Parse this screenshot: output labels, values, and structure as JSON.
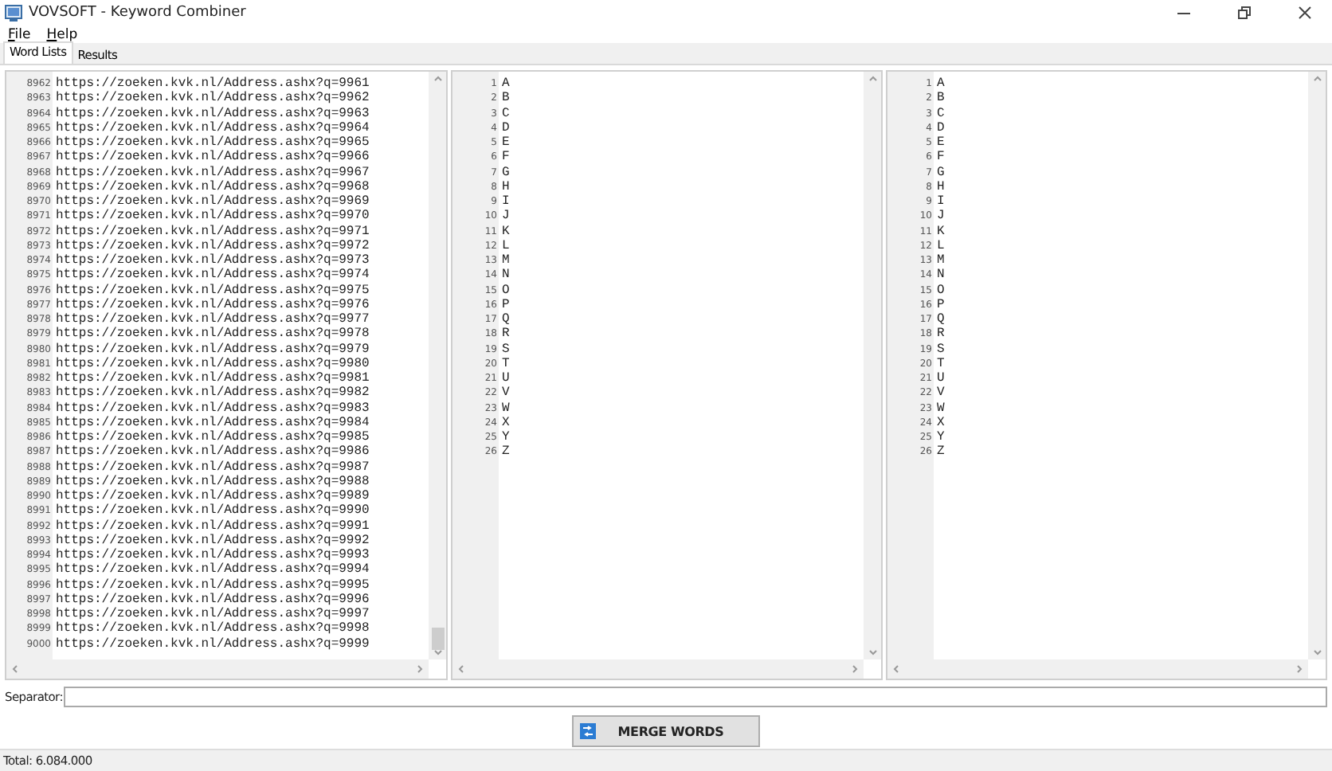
{
  "window": {
    "title": "VOVSOFT - Keyword Combiner"
  },
  "menu": [
    "File",
    "Help"
  ],
  "tabs": [
    {
      "label": "Word Lists",
      "selected": true
    },
    {
      "label": "Results",
      "selected": false
    }
  ],
  "word_lists": [
    {
      "lines": [
        {
          "n": "8962",
          "t": "https://zoeken.kvk.nl/Address.ashx?q=9961"
        },
        {
          "n": "8963",
          "t": "https://zoeken.kvk.nl/Address.ashx?q=9962"
        },
        {
          "n": "8964",
          "t": "https://zoeken.kvk.nl/Address.ashx?q=9963"
        },
        {
          "n": "8965",
          "t": "https://zoeken.kvk.nl/Address.ashx?q=9964"
        },
        {
          "n": "8966",
          "t": "https://zoeken.kvk.nl/Address.ashx?q=9965"
        },
        {
          "n": "8967",
          "t": "https://zoeken.kvk.nl/Address.ashx?q=9966"
        },
        {
          "n": "8968",
          "t": "https://zoeken.kvk.nl/Address.ashx?q=9967"
        },
        {
          "n": "8969",
          "t": "https://zoeken.kvk.nl/Address.ashx?q=9968"
        },
        {
          "n": "8970",
          "t": "https://zoeken.kvk.nl/Address.ashx?q=9969"
        },
        {
          "n": "8971",
          "t": "https://zoeken.kvk.nl/Address.ashx?q=9970"
        },
        {
          "n": "8972",
          "t": "https://zoeken.kvk.nl/Address.ashx?q=9971"
        },
        {
          "n": "8973",
          "t": "https://zoeken.kvk.nl/Address.ashx?q=9972"
        },
        {
          "n": "8974",
          "t": "https://zoeken.kvk.nl/Address.ashx?q=9973"
        },
        {
          "n": "8975",
          "t": "https://zoeken.kvk.nl/Address.ashx?q=9974"
        },
        {
          "n": "8976",
          "t": "https://zoeken.kvk.nl/Address.ashx?q=9975"
        },
        {
          "n": "8977",
          "t": "https://zoeken.kvk.nl/Address.ashx?q=9976"
        },
        {
          "n": "8978",
          "t": "https://zoeken.kvk.nl/Address.ashx?q=9977"
        },
        {
          "n": "8979",
          "t": "https://zoeken.kvk.nl/Address.ashx?q=9978"
        },
        {
          "n": "8980",
          "t": "https://zoeken.kvk.nl/Address.ashx?q=9979"
        },
        {
          "n": "8981",
          "t": "https://zoeken.kvk.nl/Address.ashx?q=9980"
        },
        {
          "n": "8982",
          "t": "https://zoeken.kvk.nl/Address.ashx?q=9981"
        },
        {
          "n": "8983",
          "t": "https://zoeken.kvk.nl/Address.ashx?q=9982"
        },
        {
          "n": "8984",
          "t": "https://zoeken.kvk.nl/Address.ashx?q=9983"
        },
        {
          "n": "8985",
          "t": "https://zoeken.kvk.nl/Address.ashx?q=9984"
        },
        {
          "n": "8986",
          "t": "https://zoeken.kvk.nl/Address.ashx?q=9985"
        },
        {
          "n": "8987",
          "t": "https://zoeken.kvk.nl/Address.ashx?q=9986"
        },
        {
          "n": "8988",
          "t": "https://zoeken.kvk.nl/Address.ashx?q=9987"
        },
        {
          "n": "8989",
          "t": "https://zoeken.kvk.nl/Address.ashx?q=9988"
        },
        {
          "n": "8990",
          "t": "https://zoeken.kvk.nl/Address.ashx?q=9989"
        },
        {
          "n": "8991",
          "t": "https://zoeken.kvk.nl/Address.ashx?q=9990"
        },
        {
          "n": "8992",
          "t": "https://zoeken.kvk.nl/Address.ashx?q=9991"
        },
        {
          "n": "8993",
          "t": "https://zoeken.kvk.nl/Address.ashx?q=9992"
        },
        {
          "n": "8994",
          "t": "https://zoeken.kvk.nl/Address.ashx?q=9993"
        },
        {
          "n": "8995",
          "t": "https://zoeken.kvk.nl/Address.ashx?q=9994"
        },
        {
          "n": "8996",
          "t": "https://zoeken.kvk.nl/Address.ashx?q=9995"
        },
        {
          "n": "8997",
          "t": "https://zoeken.kvk.nl/Address.ashx?q=9996"
        },
        {
          "n": "8998",
          "t": "https://zoeken.kvk.nl/Address.ashx?q=9997"
        },
        {
          "n": "8999",
          "t": "https://zoeken.kvk.nl/Address.ashx?q=9998"
        },
        {
          "n": "9000",
          "t": "https://zoeken.kvk.nl/Address.ashx?q=9999"
        }
      ]
    },
    {
      "lines": [
        {
          "n": "1",
          "t": "A"
        },
        {
          "n": "2",
          "t": "B"
        },
        {
          "n": "3",
          "t": "C"
        },
        {
          "n": "4",
          "t": "D"
        },
        {
          "n": "5",
          "t": "E"
        },
        {
          "n": "6",
          "t": "F"
        },
        {
          "n": "7",
          "t": "G"
        },
        {
          "n": "8",
          "t": "H"
        },
        {
          "n": "9",
          "t": "I"
        },
        {
          "n": "10",
          "t": "J"
        },
        {
          "n": "11",
          "t": "K"
        },
        {
          "n": "12",
          "t": "L"
        },
        {
          "n": "13",
          "t": "M"
        },
        {
          "n": "14",
          "t": "N"
        },
        {
          "n": "15",
          "t": "O"
        },
        {
          "n": "16",
          "t": "P"
        },
        {
          "n": "17",
          "t": "Q"
        },
        {
          "n": "18",
          "t": "R"
        },
        {
          "n": "19",
          "t": "S"
        },
        {
          "n": "20",
          "t": "T"
        },
        {
          "n": "21",
          "t": "U"
        },
        {
          "n": "22",
          "t": "V"
        },
        {
          "n": "23",
          "t": "W"
        },
        {
          "n": "24",
          "t": "X"
        },
        {
          "n": "25",
          "t": "Y"
        },
        {
          "n": "26",
          "t": "Z"
        }
      ]
    },
    {
      "lines": [
        {
          "n": "1",
          "t": "A"
        },
        {
          "n": "2",
          "t": "B"
        },
        {
          "n": "3",
          "t": "C"
        },
        {
          "n": "4",
          "t": "D"
        },
        {
          "n": "5",
          "t": "E"
        },
        {
          "n": "6",
          "t": "F"
        },
        {
          "n": "7",
          "t": "G"
        },
        {
          "n": "8",
          "t": "H"
        },
        {
          "n": "9",
          "t": "I"
        },
        {
          "n": "10",
          "t": "J"
        },
        {
          "n": "11",
          "t": "K"
        },
        {
          "n": "12",
          "t": "L"
        },
        {
          "n": "13",
          "t": "M"
        },
        {
          "n": "14",
          "t": "N"
        },
        {
          "n": "15",
          "t": "O"
        },
        {
          "n": "16",
          "t": "P"
        },
        {
          "n": "17",
          "t": "Q"
        },
        {
          "n": "18",
          "t": "R"
        },
        {
          "n": "19",
          "t": "S"
        },
        {
          "n": "20",
          "t": "T"
        },
        {
          "n": "21",
          "t": "U"
        },
        {
          "n": "22",
          "t": "V"
        },
        {
          "n": "23",
          "t": "W"
        },
        {
          "n": "24",
          "t": "X"
        },
        {
          "n": "25",
          "t": "Y"
        },
        {
          "n": "26",
          "t": "Z"
        }
      ]
    }
  ],
  "separator": {
    "label": "Separator:"
  },
  "merge_button": {
    "label": "MERGE WORDS"
  },
  "status_bar": {
    "total": "Total: 6.084.000"
  }
}
